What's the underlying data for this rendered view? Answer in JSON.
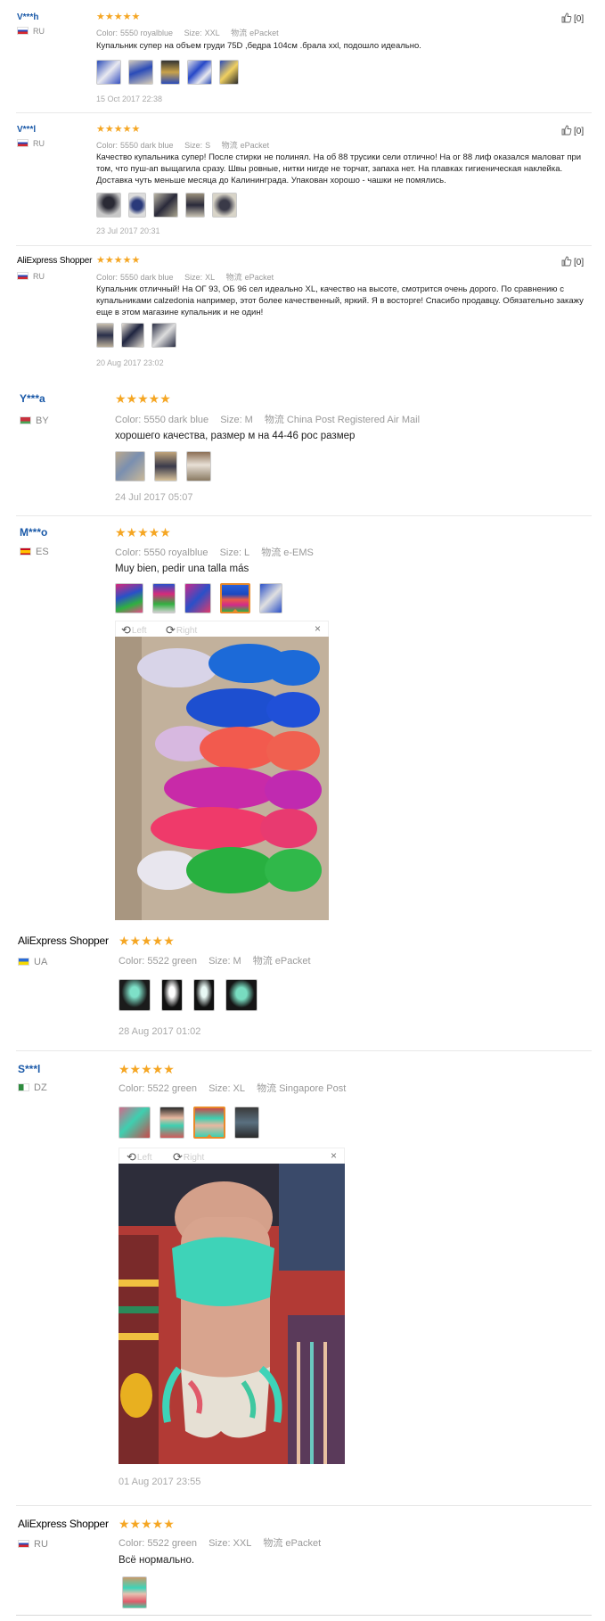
{
  "like_label": "[0]",
  "labels": {
    "color": "Color:",
    "size": "Size:",
    "shipping": "物流"
  },
  "viewer": {
    "left": "Left",
    "right": "Right",
    "close": "×"
  },
  "stars": "★★★★★",
  "reviews": [
    {
      "name": "V***h",
      "country": "RU",
      "color": "5550 royalblue",
      "size": "XXL",
      "shipping": "ePacket",
      "text": "Купальник супер на объем груди 75D ,бедра 104см .брала xxl, подошло идеально.",
      "date": "15 Oct 2017 22:38"
    },
    {
      "name": "V***l",
      "country": "RU",
      "color": "5550 dark blue",
      "size": "S",
      "shipping": "ePacket",
      "text": "Качество купальника супер! После стирки не полинял. На об 88 трусики сели отлично! На ог 88 лиф оказался маловат при том, что пуш-ап выщагила сразу. Швы ровные, нитки нигде не торчат, запаха нет. На плавках гигиеническая наклейка. Доставка чуть меньше месяца до Калининграда. Упакован хорошо - чашки не помялись.",
      "date": "23 Jul 2017 20:31"
    },
    {
      "name": "AliExpress Shopper",
      "country": "RU",
      "color": "5550 dark blue",
      "size": "XL",
      "shipping": "ePacket",
      "text": "Купальник отличный! На ОГ 93, ОБ 96 сел идеально XL, качество на высоте, смотрится очень дорого. По сравнению с купальниками calzedonia например, этот более качественный, яркий. Я в восторге! Спасибо продавцу. Обязательно закажу еще в этом магазине купальник и не один!",
      "date": "20 Aug 2017 23:02"
    },
    {
      "name": "Y***a",
      "country": "BY",
      "color": "5550 dark blue",
      "size": "M",
      "shipping": "China Post Registered Air Mail",
      "text": "хорошего качества, размер м на 44-46 рос размер",
      "date": "24 Jul 2017 05:07"
    },
    {
      "name": "M***o",
      "country": "ES",
      "color": "5550 royalblue",
      "size": "L",
      "shipping": "e-EMS",
      "text": "Muy bien, pedir una talla más"
    },
    {
      "name": "AliExpress Shopper",
      "country": "UA",
      "color": "5522 green",
      "size": "M",
      "shipping": "ePacket",
      "date": "28 Aug 2017 01:02"
    },
    {
      "name": "S***l",
      "country": "DZ",
      "color": "5522 green",
      "size": "XL",
      "shipping": "Singapore Post",
      "date": "01 Aug 2017 23:55"
    },
    {
      "name": "AliExpress Shopper",
      "country": "RU",
      "color": "5522 green",
      "size": "XXL",
      "shipping": "ePacket",
      "text": "Всё нормально."
    }
  ]
}
